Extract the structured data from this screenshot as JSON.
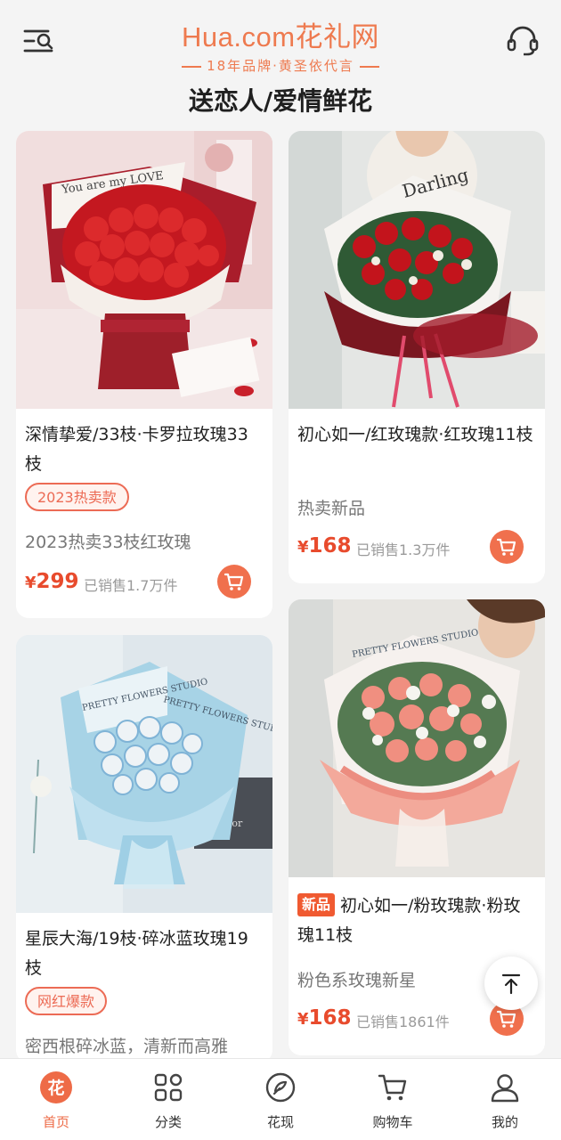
{
  "header": {
    "logo_text": "Hua.com花礼网",
    "logo_slogan": "18年品牌·黄圣依代言",
    "page_title": "送恋人/爱情鲜花"
  },
  "products": [
    {
      "title": "深情挚爱/33枝·卡罗拉玫瑰33枝",
      "badge": "2023热卖款",
      "subtitle": "2023热卖33枝红玫瑰",
      "currency": "¥",
      "price": "299",
      "sales": "已销售1.7万件"
    },
    {
      "title": "初心如一/红玫瑰款·红玫瑰11枝",
      "subtitle": "热卖新品",
      "currency": "¥",
      "price": "168",
      "sales": "已销售1.3万件"
    },
    {
      "title": "星辰大海/19枝·碎冰蓝玫瑰19枝",
      "badge": "网红爆款",
      "subtitle": "密西根碎冰蓝，清新而高雅"
    },
    {
      "tag": "新品",
      "title": "初心如一/粉玫瑰款·粉玫瑰11枝",
      "subtitle": "粉色系玫瑰新星",
      "currency": "¥",
      "price": "168",
      "sales": "已销售1861件"
    }
  ],
  "image_text": {
    "card1_wrap": "You are my LOVE",
    "card2_wrap": "Darling",
    "card3_wrap": "PRETTY FLOWERS STUDIO",
    "card4_wrap": "PRETTY FLOWERS STUDIO"
  },
  "bottom_nav": [
    {
      "label": "首页",
      "icon": "home-flower-icon",
      "active": true
    },
    {
      "label": "分类",
      "icon": "category-grid-icon"
    },
    {
      "label": "花现",
      "icon": "discover-chat-icon"
    },
    {
      "label": "购物车",
      "icon": "cart-icon"
    },
    {
      "label": "我的",
      "icon": "profile-icon"
    }
  ],
  "colors": {
    "accent": "#ee7a4f",
    "price": "#e84b2d",
    "cart_button": "#f0704d",
    "background": "#f4f4f4"
  }
}
